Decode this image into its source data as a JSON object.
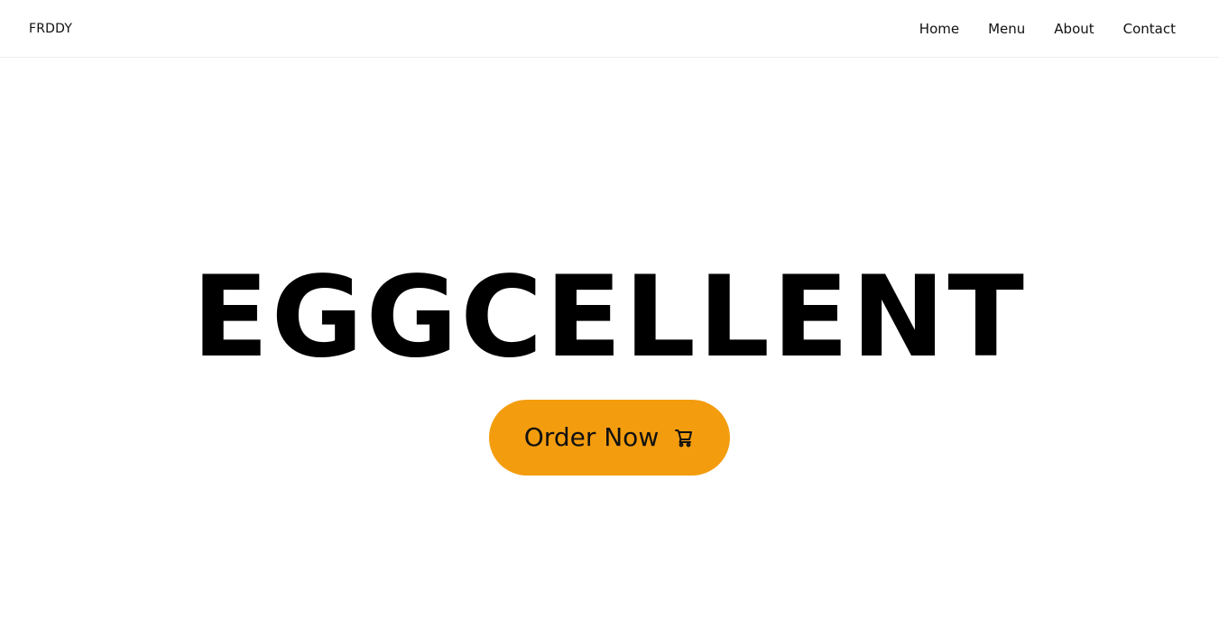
{
  "header": {
    "brand": "FRDDY",
    "nav": [
      {
        "label": "Home"
      },
      {
        "label": "Menu"
      },
      {
        "label": "About"
      },
      {
        "label": "Contact"
      }
    ]
  },
  "hero": {
    "title": "EGGCELLENT",
    "cta_label": "Order Now",
    "cta_icon": "shopping-cart-icon"
  },
  "colors": {
    "accent": "#f39c0e",
    "text": "#111111",
    "background": "#ffffff"
  }
}
